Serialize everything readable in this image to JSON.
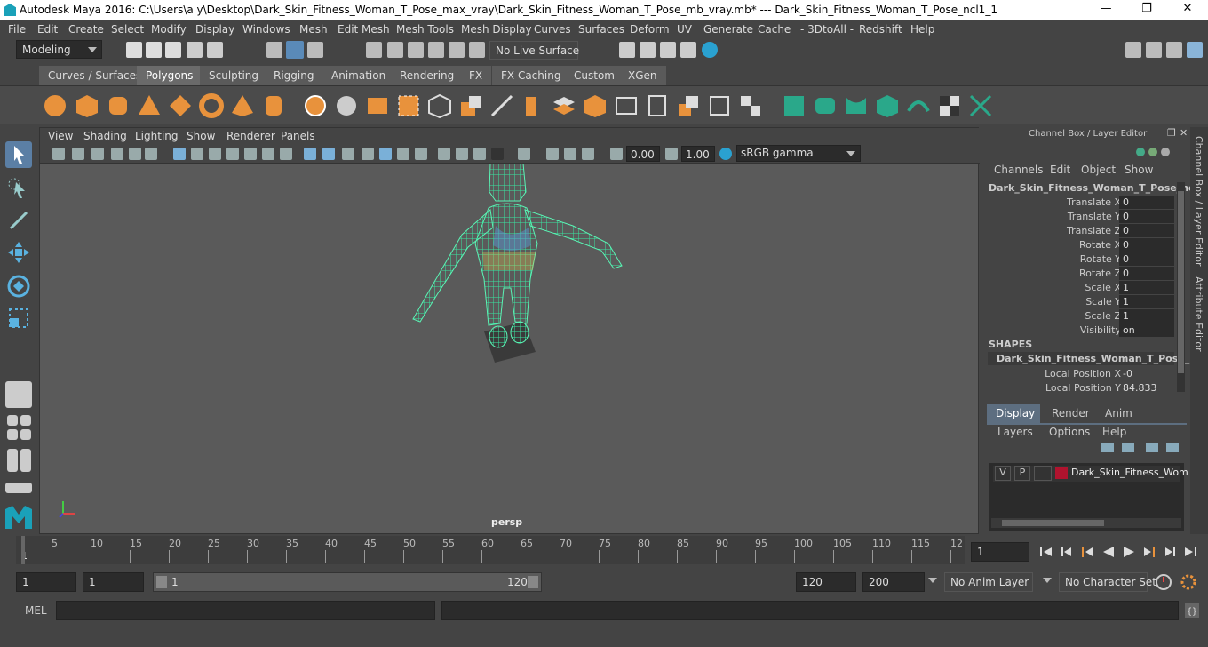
{
  "window": {
    "title": "Autodesk Maya 2016: C:\\Users\\a y\\Desktop\\Dark_Skin_Fitness_Woman_T_Pose_max_vray\\Dark_Skin_Fitness_Woman_T_Pose_mb_vray.mb*   ---   Dark_Skin_Fitness_Woman_T_Pose_ncl1_1",
    "minimize": "—",
    "maximize": "❐",
    "close": "✕"
  },
  "menubar": [
    "File",
    "Edit",
    "Create",
    "Select",
    "Modify",
    "Display",
    "Windows",
    "Mesh",
    "Edit Mesh",
    "Mesh Tools",
    "Mesh Display",
    "Curves",
    "Surfaces",
    "Deform",
    "UV",
    "Generate",
    "Cache",
    "- 3DtoAll -",
    "Redshift",
    "Help"
  ],
  "statusline": {
    "menuset": "Modeling",
    "live_surface": "No Live Surface"
  },
  "shelf_tabs": [
    "Curves / Surfaces",
    "Polygons",
    "Sculpting",
    "Rigging",
    "Animation",
    "Rendering",
    "FX",
    "FX Caching",
    "Custom",
    "XGen"
  ],
  "shelf_active": "Polygons",
  "viewport": {
    "menu": [
      "View",
      "Shading",
      "Lighting",
      "Show",
      "Renderer",
      "Panels"
    ],
    "exposure": "0.00",
    "gamma": "1.00",
    "colorspace": "sRGB gamma",
    "camera": "persp"
  },
  "channelbox": {
    "header": "Channel Box / Layer Editor",
    "menu": [
      "Channels",
      "Edit",
      "Object",
      "Show"
    ],
    "object": "Dark_Skin_Fitness_Woman_T_Pose_nc...",
    "attributes": [
      {
        "label": "Translate X",
        "value": "0"
      },
      {
        "label": "Translate Y",
        "value": "0"
      },
      {
        "label": "Translate Z",
        "value": "0"
      },
      {
        "label": "Rotate X",
        "value": "0"
      },
      {
        "label": "Rotate Y",
        "value": "0"
      },
      {
        "label": "Rotate Z",
        "value": "0"
      },
      {
        "label": "Scale X",
        "value": "1"
      },
      {
        "label": "Scale Y",
        "value": "1"
      },
      {
        "label": "Scale Z",
        "value": "1"
      },
      {
        "label": "Visibility",
        "value": "on"
      }
    ],
    "shapes_header": "SHAPES",
    "shape_name": "Dark_Skin_Fitness_Woman_T_Pose_...",
    "shape_attrs": [
      {
        "label": "Local Position X",
        "value": "-0"
      },
      {
        "label": "Local Position Y",
        "value": "84.833"
      }
    ],
    "layer_tabs": [
      "Display",
      "Render",
      "Anim"
    ],
    "layer_menu": [
      "Layers",
      "Options",
      "Help"
    ],
    "layer": {
      "v": "V",
      "p": "P",
      "name": "Dark_Skin_Fitness_Wom",
      "color": "#b0132e"
    }
  },
  "side_tabs": [
    "Channel Box / Layer Editor",
    "Attribute Editor"
  ],
  "timeline": {
    "ticks": [
      "5",
      "10",
      "15",
      "20",
      "25",
      "30",
      "35",
      "40",
      "45",
      "50",
      "55",
      "60",
      "65",
      "70",
      "75",
      "80",
      "85",
      "90",
      "95",
      "100",
      "105",
      "110",
      "115",
      "12"
    ],
    "start_tick": "1",
    "current_frame": "1"
  },
  "range": {
    "start": "1",
    "playback_start": "1",
    "slider_start": "1",
    "slider_end": "120",
    "playback_end": "120",
    "end": "200",
    "anim_layer": "No Anim Layer",
    "character_set": "No Character Set"
  },
  "command": {
    "label": "MEL"
  }
}
